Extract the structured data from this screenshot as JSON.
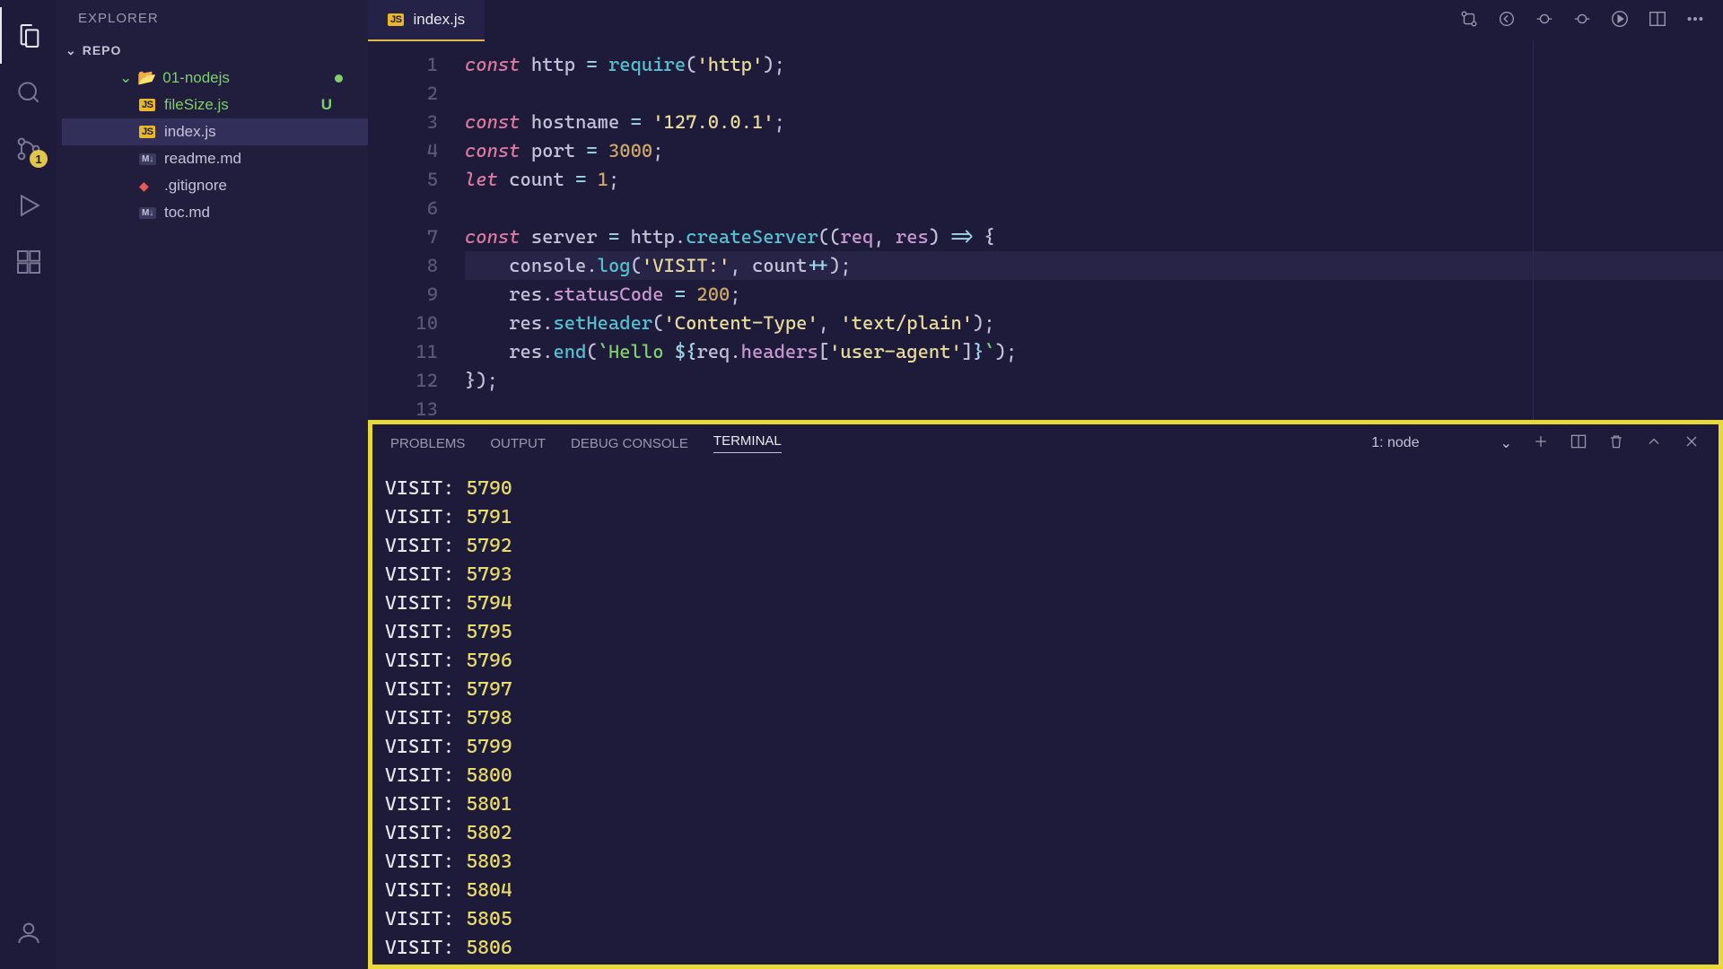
{
  "activityBar": {
    "sourceControlBadge": "1"
  },
  "sidebar": {
    "title": "EXPLORER",
    "section": "REPO",
    "folder": "01-nodejs",
    "files": [
      {
        "name": "fileSize.js",
        "icon": "js",
        "status": "U"
      },
      {
        "name": "index.js",
        "icon": "js",
        "selected": true
      },
      {
        "name": "readme.md",
        "icon": "md"
      },
      {
        "name": ".gitignore",
        "icon": "git"
      },
      {
        "name": "toc.md",
        "icon": "md"
      }
    ]
  },
  "tab": {
    "label": "index.js"
  },
  "editor": {
    "lineNumbers": [
      "1",
      "2",
      "3",
      "4",
      "5",
      "6",
      "7",
      "8",
      "9",
      "10",
      "11",
      "12",
      "13"
    ]
  },
  "code": {
    "l1": {
      "a": "const",
      "b": "http",
      "c": "=",
      "d": "require",
      "e": "(",
      "f": "'http'",
      "g": ");"
    },
    "l3": {
      "a": "const",
      "b": "hostname",
      "c": "=",
      "d": "'127.0.0.1'",
      "e": ";"
    },
    "l4": {
      "a": "const",
      "b": "port",
      "c": "=",
      "d": "3000",
      "e": ";"
    },
    "l5": {
      "a": "let",
      "b": "count",
      "c": "=",
      "d": "1",
      "e": ";"
    },
    "l7": {
      "a": "const",
      "b": "server",
      "c": "=",
      "d": "http",
      "dot": ".",
      "e": "createServer",
      "f": "((",
      "g": "req",
      "h": ", ",
      "i": "res",
      "j": ") ",
      "k": "=>",
      "l": " {"
    },
    "l8": {
      "a": "console",
      "dot": ".",
      "b": "log",
      "c": "(",
      "d": "'VISIT:'",
      "e": ", ",
      "f": "count",
      "g": "++",
      "h": ");"
    },
    "l9": {
      "a": "res",
      "dot": ".",
      "b": "statusCode",
      "c": " = ",
      "d": "200",
      "e": ";"
    },
    "l10": {
      "a": "res",
      "dot": ".",
      "b": "setHeader",
      "c": "(",
      "d": "'Content-Type'",
      "e": ", ",
      "f": "'text/plain'",
      "g": ");"
    },
    "l11": {
      "a": "res",
      "dot": ".",
      "b": "end",
      "c": "(",
      "d": "`Hello ",
      "e": "${",
      "f": "req",
      "dot2": ".",
      "g": "headers",
      "h": "[",
      "i": "'user-agent'",
      "j": "]",
      "k": "}",
      "l": "`",
      "m": ");"
    },
    "l12": {
      "a": "});"
    }
  },
  "panel": {
    "tabs": [
      "PROBLEMS",
      "OUTPUT",
      "DEBUG CONSOLE",
      "TERMINAL"
    ],
    "activeTab": 3,
    "terminalSelector": "1: node",
    "output": [
      {
        "label": "VISIT:",
        "n": "5790"
      },
      {
        "label": "VISIT:",
        "n": "5791"
      },
      {
        "label": "VISIT:",
        "n": "5792"
      },
      {
        "label": "VISIT:",
        "n": "5793"
      },
      {
        "label": "VISIT:",
        "n": "5794"
      },
      {
        "label": "VISIT:",
        "n": "5795"
      },
      {
        "label": "VISIT:",
        "n": "5796"
      },
      {
        "label": "VISIT:",
        "n": "5797"
      },
      {
        "label": "VISIT:",
        "n": "5798"
      },
      {
        "label": "VISIT:",
        "n": "5799"
      },
      {
        "label": "VISIT:",
        "n": "5800"
      },
      {
        "label": "VISIT:",
        "n": "5801"
      },
      {
        "label": "VISIT:",
        "n": "5802"
      },
      {
        "label": "VISIT:",
        "n": "5803"
      },
      {
        "label": "VISIT:",
        "n": "5804"
      },
      {
        "label": "VISIT:",
        "n": "5805"
      },
      {
        "label": "VISIT:",
        "n": "5806"
      }
    ]
  }
}
